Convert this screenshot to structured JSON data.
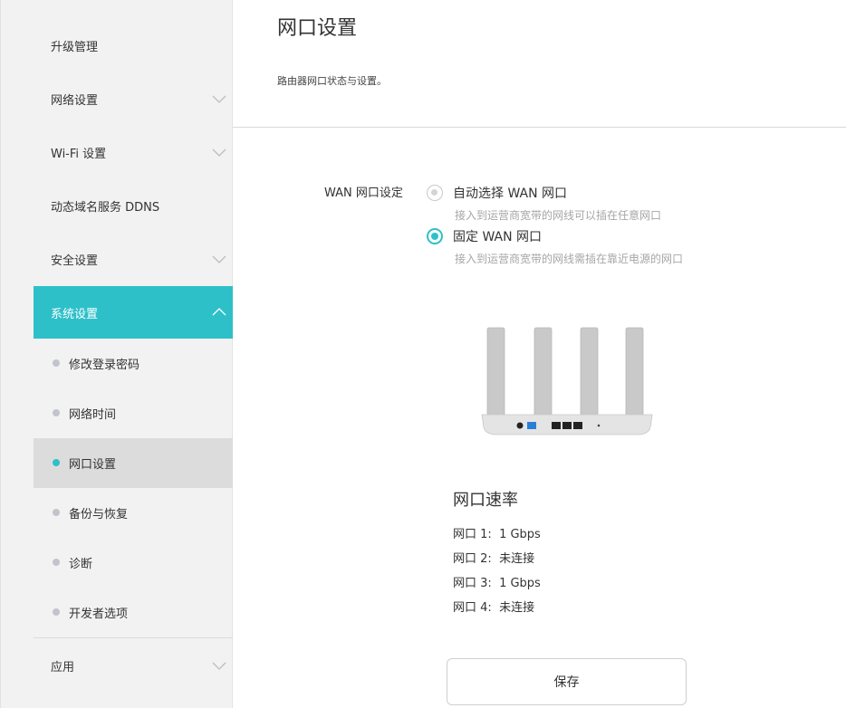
{
  "sidebar": {
    "items": [
      {
        "label": "升级管理"
      },
      {
        "label": "网络设置"
      },
      {
        "label": "Wi-Fi 设置"
      },
      {
        "label": "动态域名服务 DDNS"
      },
      {
        "label": "安全设置"
      },
      {
        "label": "系统设置"
      },
      {
        "label": "应用"
      }
    ],
    "sub_items": [
      {
        "label": "修改登录密码"
      },
      {
        "label": "网络时间"
      },
      {
        "label": "网口设置"
      },
      {
        "label": "备份与恢复"
      },
      {
        "label": "诊断"
      },
      {
        "label": "开发者选项"
      }
    ],
    "accent": "#2ec0c9"
  },
  "main": {
    "title": "网口设置",
    "description": "路由器网口状态与设置。",
    "wan": {
      "label": "WAN 网口设定",
      "options": [
        {
          "label": "自动选择 WAN 网口",
          "hint": "接入到运营商宽带的网线可以插在任意网口",
          "selected": false
        },
        {
          "label": "固定 WAN 网口",
          "hint": "接入到运营商宽带的网线需插在靠近电源的网口",
          "selected": true
        }
      ]
    },
    "speed": {
      "title": "网口速率",
      "ports": [
        {
          "name": "网口 1:",
          "value": "1 Gbps"
        },
        {
          "name": "网口 2:",
          "value": "未连接"
        },
        {
          "name": "网口 3:",
          "value": "1 Gbps"
        },
        {
          "name": "网口 4:",
          "value": "未连接"
        }
      ]
    },
    "save_label": "保存"
  }
}
